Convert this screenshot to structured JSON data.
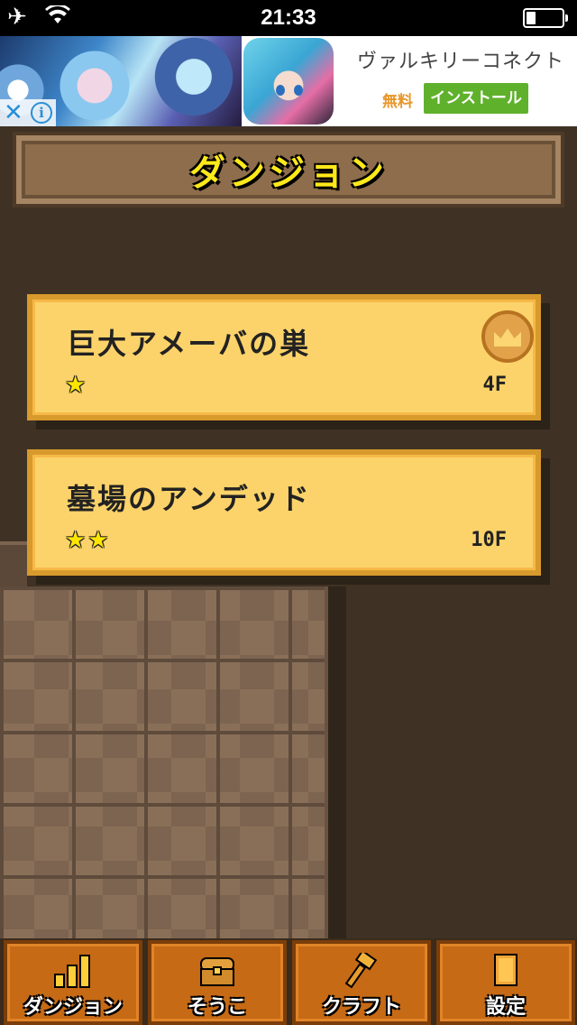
{
  "status_bar": {
    "time": "21:33",
    "battery_level": 0.25
  },
  "ad": {
    "title": "ヴァルキリーコネクト",
    "price": "無料",
    "install_label": "インストール",
    "close_glyph": "✕",
    "info_glyph": "i"
  },
  "header": {
    "title": "ダンジョン"
  },
  "dungeons": [
    {
      "name": "巨大アメーバの巣",
      "stars": "★",
      "floors": "4F",
      "cleared": true
    },
    {
      "name": "墓場のアンデッド",
      "stars": "★★",
      "floors": "10F",
      "cleared": false
    }
  ],
  "nav": {
    "items": [
      {
        "label": "ダンジョン",
        "icon": "bar-chart-icon"
      },
      {
        "label": "そうこ",
        "icon": "chest-icon"
      },
      {
        "label": "クラフト",
        "icon": "hammer-icon"
      },
      {
        "label": "設定",
        "icon": "card-icon"
      }
    ]
  },
  "colors": {
    "background": "#3f3224",
    "card": "#fcd36a",
    "title_text": "#ffe91a",
    "nav_button": "#c66a16",
    "install_button": "#5fb12c"
  }
}
